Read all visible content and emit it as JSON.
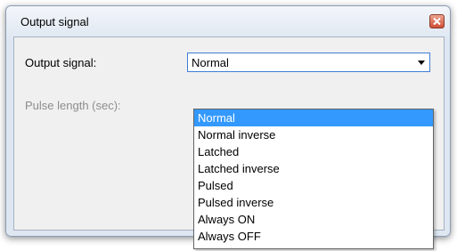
{
  "dialog": {
    "title": "Output signal",
    "close_icon": "close-x-icon",
    "accent_color": "#3399ff"
  },
  "form": {
    "output_signal_label": "Output signal:",
    "pulse_length_label": "Pulse length (sec):",
    "output_signal_value": "Normal"
  },
  "dropdown": {
    "options": [
      "Normal",
      "Normal inverse",
      "Latched",
      "Latched inverse",
      "Pulsed",
      "Pulsed inverse",
      "Always ON",
      "Always OFF"
    ],
    "selected_index": 0
  }
}
